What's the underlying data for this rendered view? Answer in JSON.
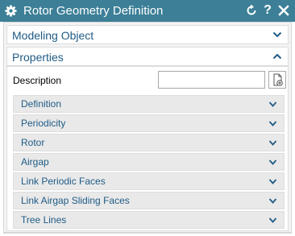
{
  "window": {
    "title": "Rotor Geometry Definition",
    "reset_icon": "reset-icon",
    "help_label": "?",
    "close_icon": "close-icon",
    "title_bar_color": "#3c7f97"
  },
  "groups": {
    "modeling_object": {
      "label": "Modeling Object",
      "expanded": false
    },
    "properties": {
      "label": "Properties",
      "expanded": true
    }
  },
  "description": {
    "label": "Description",
    "value": "",
    "placeholder": "",
    "button_icon": "add-document-icon"
  },
  "subsections": [
    {
      "label": "Definition"
    },
    {
      "label": "Periodicity"
    },
    {
      "label": "Rotor"
    },
    {
      "label": "Airgap"
    },
    {
      "label": "Link Periodic Faces"
    },
    {
      "label": "Link Airgap Sliding Faces"
    },
    {
      "label": "Tree Lines"
    }
  ],
  "colors": {
    "label_text": "#1f5b86",
    "subsection_bg": "#e9e9e9"
  }
}
